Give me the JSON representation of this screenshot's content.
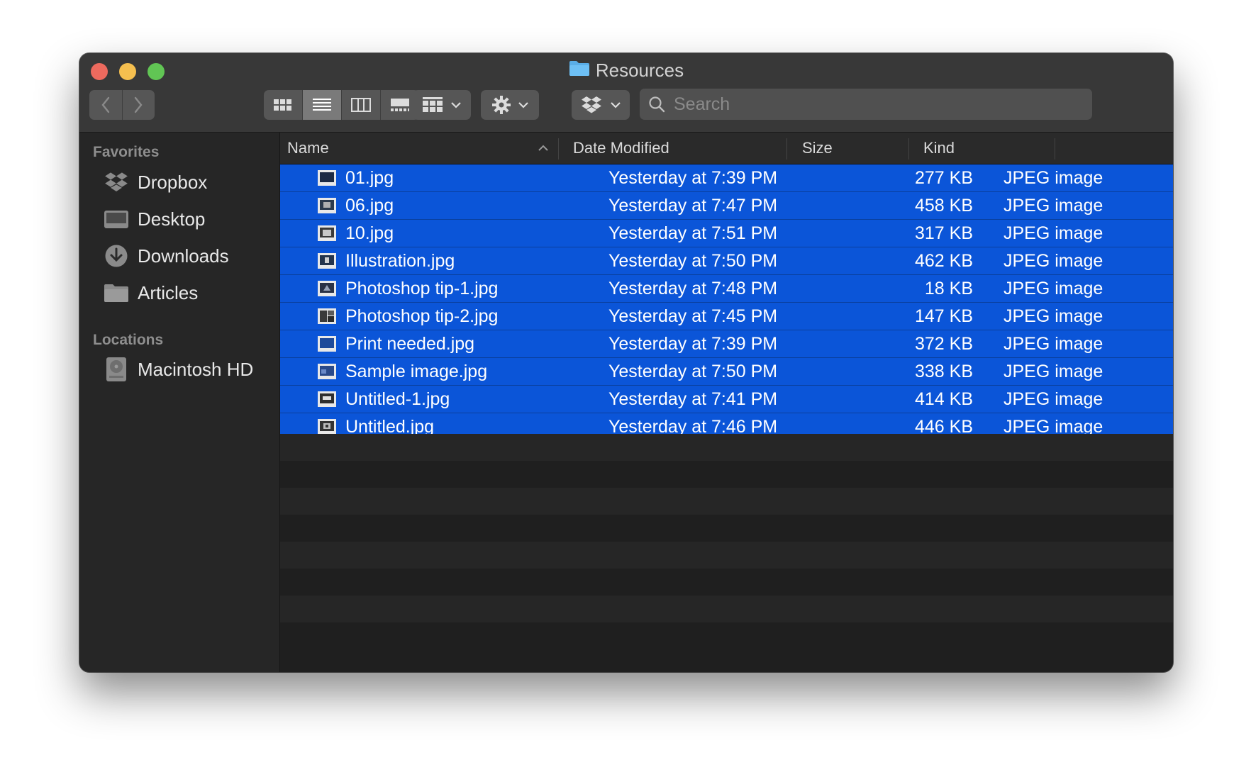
{
  "window": {
    "title": "Resources"
  },
  "toolbar": {
    "search_placeholder": "Search"
  },
  "sidebar": {
    "favorites_heading": "Favorites",
    "favorites": [
      {
        "label": "Dropbox",
        "icon": "dropbox-icon"
      },
      {
        "label": "Desktop",
        "icon": "desktop-folder-icon"
      },
      {
        "label": "Downloads",
        "icon": "downloads-icon"
      },
      {
        "label": "Articles",
        "icon": "folder-icon"
      }
    ],
    "locations_heading": "Locations",
    "locations": [
      {
        "label": "Macintosh HD",
        "icon": "hard-drive-icon"
      }
    ]
  },
  "columns": {
    "name": "Name",
    "date": "Date Modified",
    "size": "Size",
    "kind": "Kind"
  },
  "files": [
    {
      "name": "01.jpg",
      "date": "Yesterday at 7:39 PM",
      "size": "277 KB",
      "kind": "JPEG image"
    },
    {
      "name": "06.jpg",
      "date": "Yesterday at 7:47 PM",
      "size": "458 KB",
      "kind": "JPEG image"
    },
    {
      "name": "10.jpg",
      "date": "Yesterday at 7:51 PM",
      "size": "317 KB",
      "kind": "JPEG image"
    },
    {
      "name": "Illustration.jpg",
      "date": "Yesterday at 7:50 PM",
      "size": "462 KB",
      "kind": "JPEG image"
    },
    {
      "name": "Photoshop tip-1.jpg",
      "date": "Yesterday at 7:48 PM",
      "size": "18 KB",
      "kind": "JPEG image"
    },
    {
      "name": "Photoshop tip-2.jpg",
      "date": "Yesterday at 7:45 PM",
      "size": "147 KB",
      "kind": "JPEG image"
    },
    {
      "name": "Print needed.jpg",
      "date": "Yesterday at 7:39 PM",
      "size": "372 KB",
      "kind": "JPEG image"
    },
    {
      "name": "Sample image.jpg",
      "date": "Yesterday at 7:50 PM",
      "size": "338 KB",
      "kind": "JPEG image"
    },
    {
      "name": "Untitled-1.jpg",
      "date": "Yesterday at 7:41 PM",
      "size": "414 KB",
      "kind": "JPEG image"
    },
    {
      "name": "Untitled.jpg",
      "date": "Yesterday at 7:46 PM",
      "size": "446 KB",
      "kind": "JPEG image"
    }
  ],
  "colors": {
    "selection": "#0b55d8",
    "close": "#ed6a5e",
    "minimize": "#f5bf4f",
    "maximize": "#61c554"
  }
}
